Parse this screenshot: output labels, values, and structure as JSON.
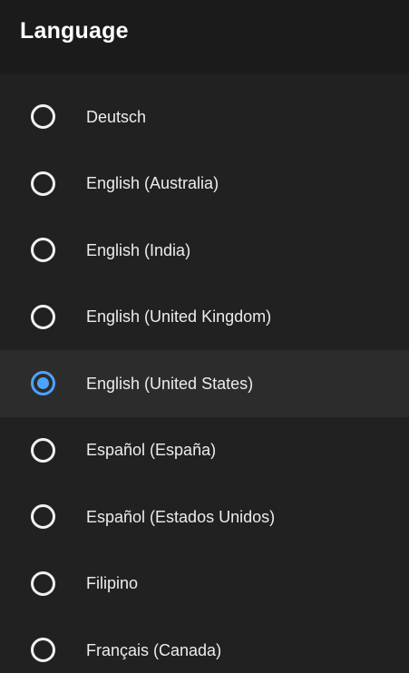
{
  "header": {
    "title": "Language"
  },
  "colors": {
    "background": "#212121",
    "header_background": "#1b1b1b",
    "selected_row_background": "#2c2c2c",
    "radio_unselected": "#f2f2f2",
    "radio_selected": "#4da3ff"
  },
  "languages": [
    {
      "label": "Deutsch",
      "selected": false
    },
    {
      "label": "English (Australia)",
      "selected": false
    },
    {
      "label": "English (India)",
      "selected": false
    },
    {
      "label": "English (United Kingdom)",
      "selected": false
    },
    {
      "label": "English (United States)",
      "selected": true
    },
    {
      "label": "Español (España)",
      "selected": false
    },
    {
      "label": "Español (Estados Unidos)",
      "selected": false
    },
    {
      "label": "Filipino",
      "selected": false
    },
    {
      "label": "Français (Canada)",
      "selected": false
    }
  ]
}
